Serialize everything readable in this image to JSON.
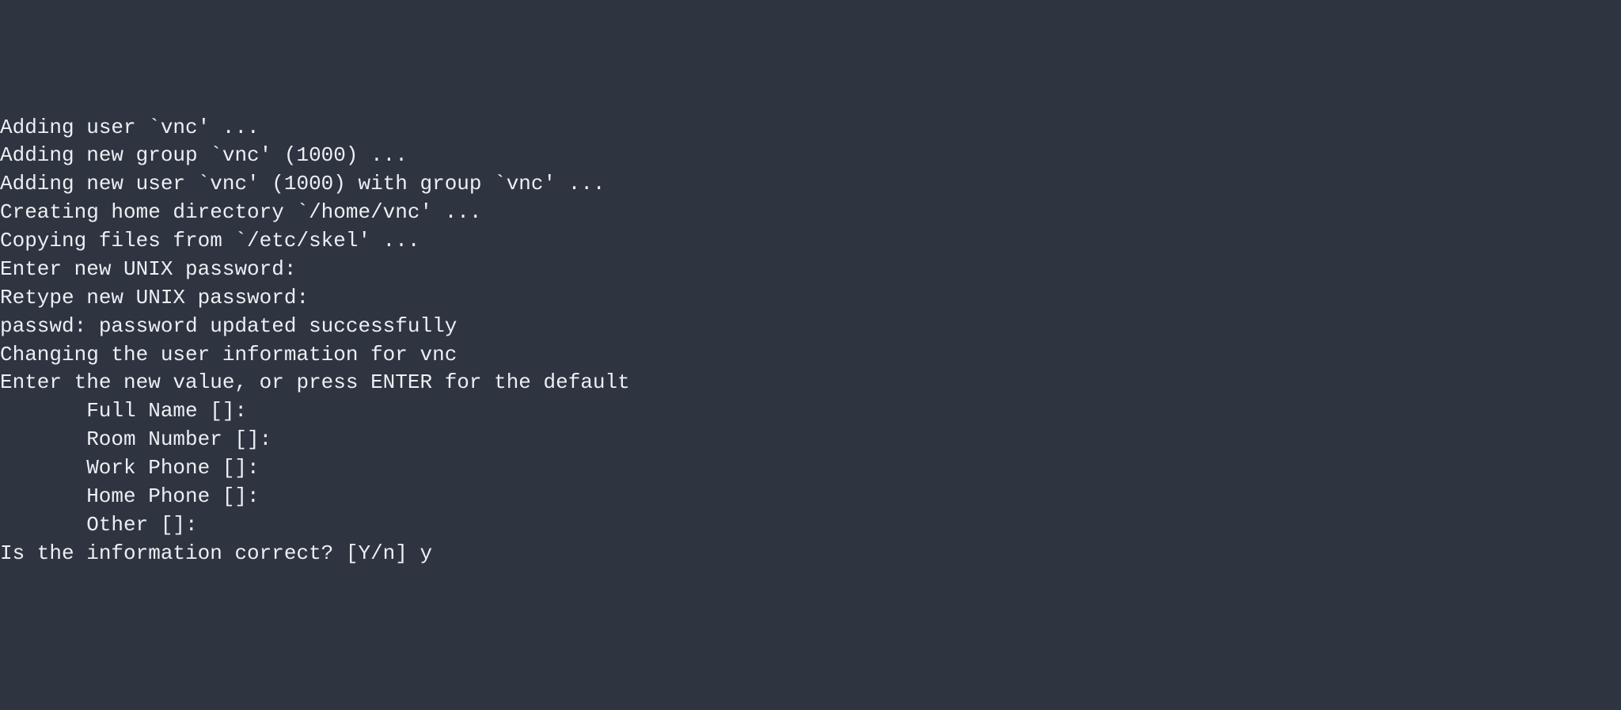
{
  "terminal": {
    "lines": [
      "Adding user `vnc' ...",
      "Adding new group `vnc' (1000) ...",
      "Adding new user `vnc' (1000) with group `vnc' ...",
      "Creating home directory `/home/vnc' ...",
      "Copying files from `/etc/skel' ...",
      "Enter new UNIX password:",
      "Retype new UNIX password:",
      "passwd: password updated successfully",
      "Changing the user information for vnc",
      "Enter the new value, or press ENTER for the default"
    ],
    "fields": [
      "Full Name []:",
      "Room Number []:",
      "Work Phone []:",
      "Home Phone []:",
      "Other []:"
    ],
    "prompt": "Is the information correct? [Y/n] ",
    "input": "y"
  }
}
